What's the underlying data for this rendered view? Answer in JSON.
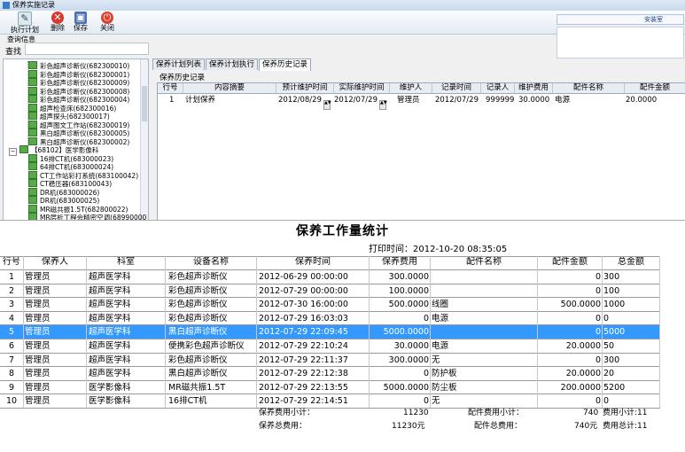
{
  "window": {
    "title": "保养实施记录"
  },
  "toolbar": {
    "exec_label": "执行计划",
    "delete_label": "删除",
    "save_label": "保存",
    "close_label": "关闭"
  },
  "right_panel": {
    "tab_label": "安装室"
  },
  "query": {
    "header": "查询信息",
    "search_label": "查找",
    "search_value": ""
  },
  "tree": {
    "items": [
      {
        "label": "彩色超声诊断仪(682300010)",
        "indent": 2,
        "type": "leaf"
      },
      {
        "label": "彩色超声诊断仪(682300001)",
        "indent": 2,
        "type": "leaf"
      },
      {
        "label": "彩色超声诊断仪(682300009)",
        "indent": 2,
        "type": "leaf"
      },
      {
        "label": "彩色超声诊断仪(682300008)",
        "indent": 2,
        "type": "leaf"
      },
      {
        "label": "彩色超声诊断仪(682300004)",
        "indent": 2,
        "type": "leaf"
      },
      {
        "label": "超声检查床(682300016)",
        "indent": 2,
        "type": "leaf"
      },
      {
        "label": "超声探头(682300017)",
        "indent": 2,
        "type": "leaf"
      },
      {
        "label": "超声图文工作站(682300019)",
        "indent": 2,
        "type": "leaf"
      },
      {
        "label": "黑白超声诊断仪(682300005)",
        "indent": 2,
        "type": "leaf"
      },
      {
        "label": "黑白超声诊断仪(682300002)",
        "indent": 2,
        "type": "leaf"
      },
      {
        "label": "【68102】医学影像科",
        "indent": 1,
        "type": "folder"
      },
      {
        "label": "16排CT机(683000023)",
        "indent": 2,
        "type": "leaf"
      },
      {
        "label": "64排CT机(683000024)",
        "indent": 2,
        "type": "leaf"
      },
      {
        "label": "CT工作站彩打系统(683100042)",
        "indent": 2,
        "type": "leaf"
      },
      {
        "label": "CT稳压器(683100043)",
        "indent": 2,
        "type": "leaf"
      },
      {
        "label": "DR机(683000026)",
        "indent": 2,
        "type": "leaf"
      },
      {
        "label": "DR机(683000025)",
        "indent": 2,
        "type": "leaf"
      },
      {
        "label": "MR磁共振1.5T(682800022)",
        "indent": 2,
        "type": "leaf"
      },
      {
        "label": "MR层析工程会精密空调(68990000",
        "indent": 2,
        "type": "leaf"
      }
    ]
  },
  "tabs": [
    {
      "label": "保养计划列表",
      "active": false
    },
    {
      "label": "保养计划执行",
      "active": false
    },
    {
      "label": "保养历史记录",
      "active": true
    }
  ],
  "history": {
    "title": "保养历史记录",
    "columns": [
      "行号",
      "内容摘要",
      "预计维护时间",
      "实际维护时间",
      "维护人",
      "记录时间",
      "记录人",
      "维护费用",
      "配件名称",
      "配件金额"
    ],
    "rows": [
      [
        "1",
        "计划保养",
        "2012/08/29",
        "2012/07/29",
        "管理员",
        "2012/07/29",
        "999999",
        "30.0000",
        "电源",
        "20.0000"
      ]
    ]
  },
  "report": {
    "title": "保养工作量统计",
    "print_time_label": "打印时间：",
    "print_time": "2012-10-20 08:35:05",
    "columns": [
      "行号",
      "保养人",
      "科室",
      "设备名称",
      "保养时间",
      "保养费用",
      "配件名称",
      "配件金额",
      "总金额"
    ],
    "rows": [
      [
        "1",
        "管理员",
        "超声医学科",
        "彩色超声诊断仪",
        "2012-06-29 00:00:00",
        "300.0000",
        "",
        "0",
        "300"
      ],
      [
        "2",
        "管理员",
        "超声医学科",
        "彩色超声诊断仪",
        "2012-07-29 00:00:00",
        "100.0000",
        "",
        "0",
        "100"
      ],
      [
        "3",
        "管理员",
        "超声医学科",
        "彩色超声诊断仪",
        "2012-07-30 16:00:00",
        "500.0000",
        "线圈",
        "500.0000",
        "1000"
      ],
      [
        "4",
        "管理员",
        "超声医学科",
        "彩色超声诊断仪",
        "2012-07-29 16:03:03",
        "0",
        "电源",
        "0",
        "0"
      ],
      [
        "5",
        "管理员",
        "超声医学科",
        "黑白超声诊断仪",
        "2012-07-29 22:09:45",
        "5000.0000",
        "",
        "0",
        "5000"
      ],
      [
        "6",
        "管理员",
        "超声医学科",
        "便携彩色超声诊断仪",
        "2012-07-29 22:10:24",
        "30.0000",
        "电源",
        "20.0000",
        "50"
      ],
      [
        "7",
        "管理员",
        "超声医学科",
        "彩色超声诊断仪",
        "2012-07-29 22:11:37",
        "300.0000",
        "无",
        "0",
        "300"
      ],
      [
        "8",
        "管理员",
        "超声医学科",
        "黑白超声诊断仪",
        "2012-07-29 22:12:38",
        "0",
        "防护板",
        "20.0000",
        "20"
      ],
      [
        "9",
        "管理员",
        "医学影像科",
        "MR磁共振1.5T",
        "2012-07-29 22:13:55",
        "5000.0000",
        "防尘板",
        "200.0000",
        "5200"
      ],
      [
        "10",
        "管理员",
        "医学影像科",
        "16排CT机",
        "2012-07-29 22:14:51",
        "0",
        "无",
        "0",
        "0"
      ]
    ],
    "selected_row": 4,
    "summary": {
      "fee_subtotal_label": "保养费用小计：",
      "fee_subtotal": "11230",
      "parts_subtotal_label": "配件费用小计：",
      "parts_subtotal": "740",
      "total_subtotal_label": "费用小计:11",
      "fee_total_label": "保养总费用：",
      "fee_total": "11230元",
      "parts_total_label": "配件总费用：",
      "parts_total": "740元",
      "grand_total_label": "费用总计:11"
    }
  }
}
